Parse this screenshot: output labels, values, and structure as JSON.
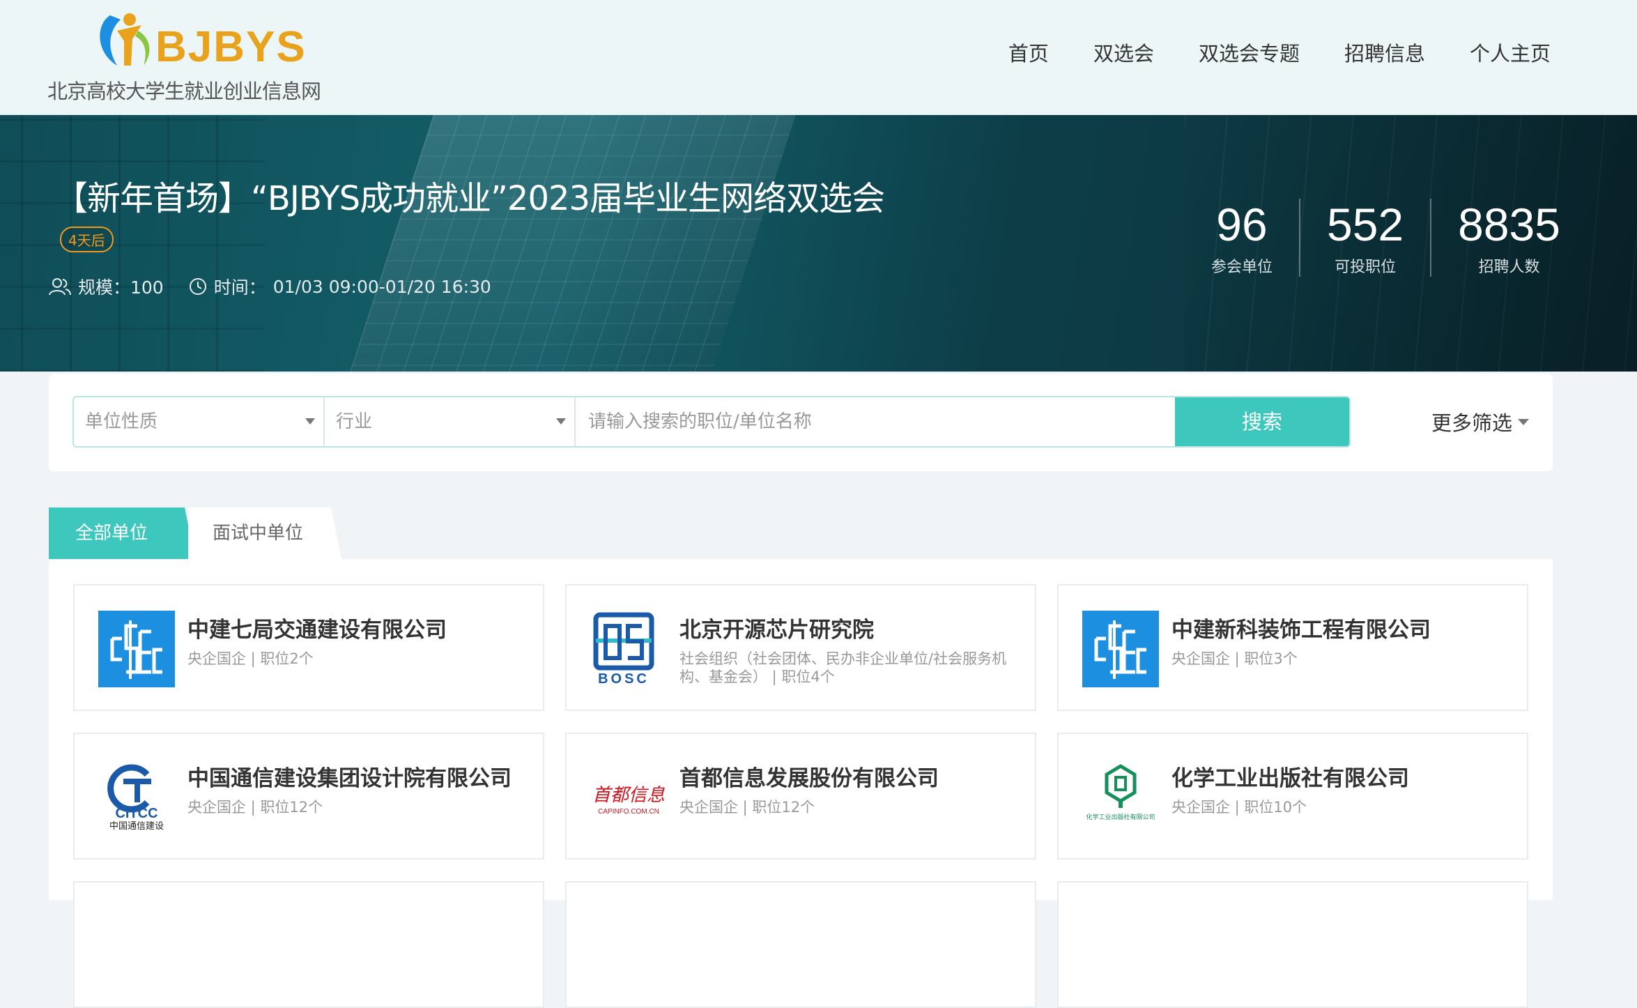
{
  "header": {
    "logo_text": "BJBYS",
    "logo_subtitle": "北京高校大学生就业创业信息网",
    "nav": [
      "首页",
      "双选会",
      "双选会专题",
      "招聘信息",
      "个人主页"
    ]
  },
  "banner": {
    "title": "【新年首场】“BJBYS成功就业”2023届毕业生网络双选会",
    "tag": "4天后",
    "scale_label": "规模：100",
    "time_label": "时间：",
    "time_value": "01/03 09:00-01/20 16:30",
    "stats": [
      {
        "value": "96",
        "label": "参会单位"
      },
      {
        "value": "552",
        "label": "可投职位"
      },
      {
        "value": "8835",
        "label": "招聘人数"
      }
    ]
  },
  "search": {
    "unit_type_placeholder": "单位性质",
    "industry_placeholder": "行业",
    "keyword_placeholder": "请输入搜索的职位/单位名称",
    "button": "搜索",
    "more_filter": "更多筛选"
  },
  "tabs": [
    "全部单位",
    "面试中单位"
  ],
  "companies": [
    {
      "name": "中建七局交通建设有限公司",
      "meta": "央企国企 |  职位2个",
      "logo": "cscec-logo"
    },
    {
      "name": "北京开源芯片研究院",
      "meta": "社会组织（社会团体、民办非企业单位/社会服务机构、基金会） |  职位4个",
      "logo": "bosc-logo"
    },
    {
      "name": "中建新科装饰工程有限公司",
      "meta": "央企国企 |  职位3个",
      "logo": "cscec-logo"
    },
    {
      "name": "中国通信建设集团设计院有限公司",
      "meta": "央企国企 |  职位12个",
      "logo": "citcc-logo",
      "logo_text": "CITCC",
      "logo_sub": "中国通信建设"
    },
    {
      "name": "首都信息发展股份有限公司",
      "meta": "央企国企 |  职位12个",
      "logo": "capinfo-logo",
      "logo_text": "首都信息",
      "logo_sub": "CAPINFO.COM.CN"
    },
    {
      "name": "化学工业出版社有限公司",
      "meta": "央企国企 |  职位10个",
      "logo": "cip-logo",
      "logo_text": "化学工业出版社有限公司"
    }
  ],
  "colors": {
    "accent": "#3ec8bd",
    "tag": "#f29a20",
    "logo_blue": "#1c8fe0"
  }
}
